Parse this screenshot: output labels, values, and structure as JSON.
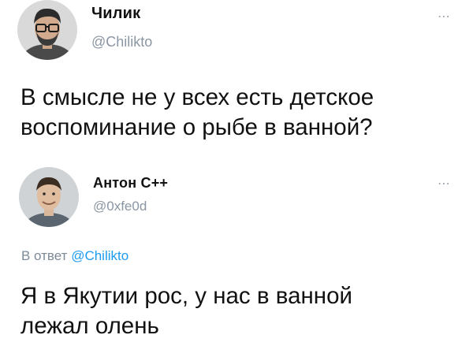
{
  "main_tweet": {
    "display_name": "Чилик",
    "handle": "@Chilikto",
    "more_icon": "⋯",
    "text_lines": [
      "В смысле не у всех есть детское",
      "воспоминание о рыбе в ванной?"
    ],
    "avatar_icon": "user-avatar-icon"
  },
  "reply_tweet": {
    "display_name": "Антон С++",
    "handle": "@0xfe0d",
    "more_icon": "⋯",
    "reply_prefix": "В ответ",
    "reply_to": "@Chilikto",
    "text_lines": [
      "Я в Якутии рос, у нас в ванной",
      "лежал олень"
    ],
    "avatar_icon": "user-avatar-icon"
  },
  "colors": {
    "link": "#1d9bf0",
    "secondary_text": "#8a96a3",
    "primary_text": "#111111"
  }
}
